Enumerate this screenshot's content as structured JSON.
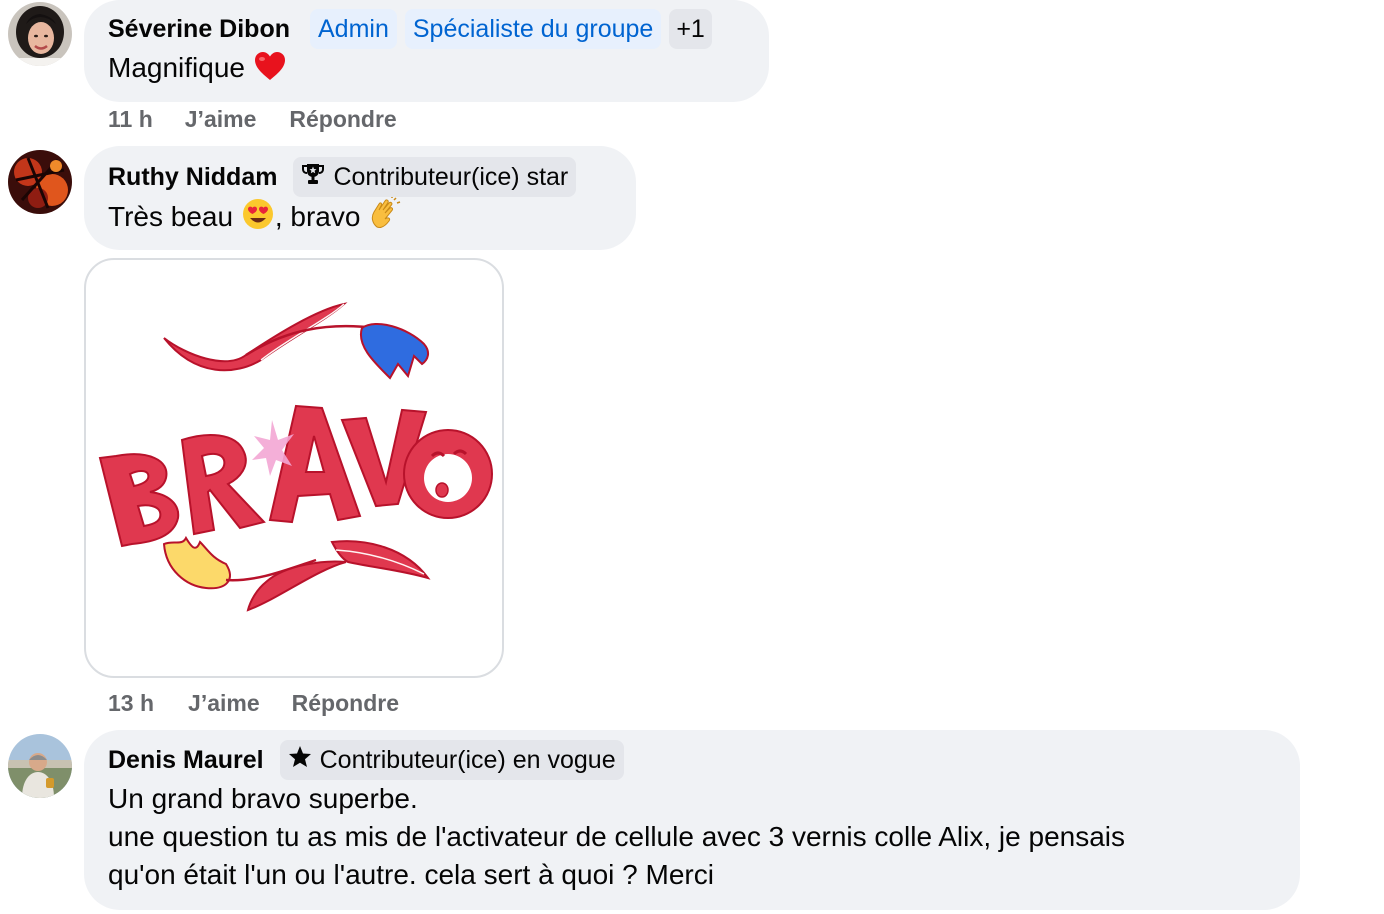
{
  "comments": [
    {
      "author": "Séverine Dibon",
      "badges": [
        "Admin",
        "Spécialiste du groupe",
        "+1"
      ],
      "text": "Magnifique",
      "emoji": "heart",
      "time": "11 h",
      "like_label": "J’aime",
      "reply_label": "Répondre"
    },
    {
      "author": "Ruthy Niddam",
      "badges": [
        "Contributeur(ice) star"
      ],
      "badge_icon": "trophy-icon",
      "text_parts": [
        "Très beau ",
        ", bravo "
      ],
      "emojis": [
        "heart-eyes",
        "clapping-hands"
      ],
      "attachment": {
        "type": "sticker",
        "word": "BRAVO"
      },
      "time": "13 h",
      "like_label": "J’aime",
      "reply_label": "Répondre"
    },
    {
      "author": "Denis Maurel",
      "badges": [
        "Contributeur(ice) en vogue"
      ],
      "badge_icon": "star-icon",
      "text_lines": [
        "Un grand bravo superbe.",
        "une question tu as mis de l'activateur de cellule avec 3 vernis colle Alix, je pensais",
        "qu'on était l'un ou l'autre. cela sert à quoi ? Merci"
      ]
    }
  ],
  "colors": {
    "bubble": "#f0f2f5",
    "badge_blue_bg": "#e7f0fd",
    "badge_blue_text": "#0064d1",
    "badge_grey_bg": "#e4e6eb",
    "meta_text": "#65676b",
    "sticker_red": "#e0384f",
    "sticker_blue": "#2f6ce0",
    "sticker_yellow": "#fcd96a",
    "sticker_pink": "#f3a6d4"
  }
}
